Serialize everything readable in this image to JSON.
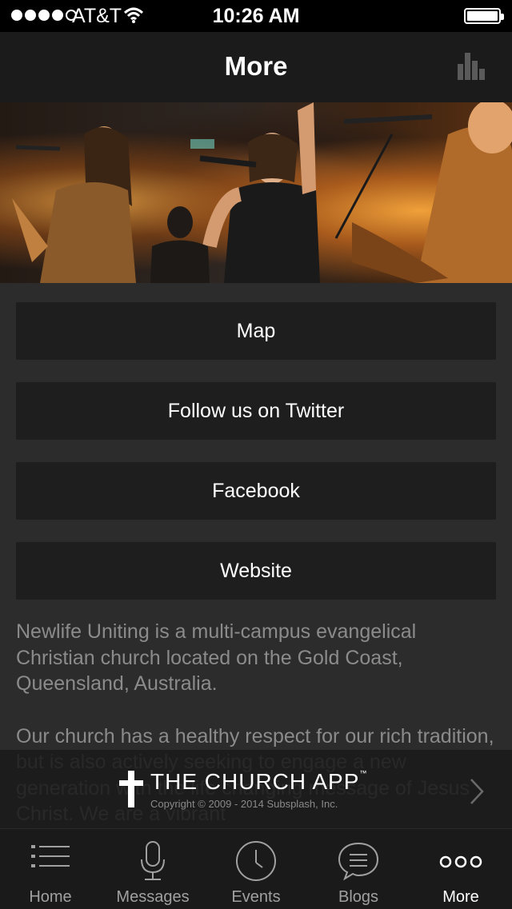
{
  "status_bar": {
    "carrier": "AT&T",
    "time": "10:26 AM"
  },
  "nav": {
    "title": "More",
    "right_icon": "chart-bars-icon"
  },
  "hero": {
    "alt": "worship-band-photo"
  },
  "buttons": [
    {
      "label": "Map"
    },
    {
      "label": "Follow us on Twitter"
    },
    {
      "label": "Facebook"
    },
    {
      "label": "Website"
    }
  ],
  "description": {
    "p1": "Newlife Uniting is a multi-campus evangelical Christian church located on the Gold Coast, Queensland, Australia.",
    "p2": "Our church has a healthy respect for our rich tradition, but is also actively seeking to engage a new generation with the life changing message of Jesus Christ. We are a vibrant"
  },
  "banner": {
    "brand": "THE CHURCH APP",
    "trademark": "™",
    "copyright": "Copyright © 2009 - 2014 Subsplash, Inc."
  },
  "tabs": [
    {
      "label": "Home",
      "icon": "list-icon"
    },
    {
      "label": "Messages",
      "icon": "microphone-icon"
    },
    {
      "label": "Events",
      "icon": "clock-icon"
    },
    {
      "label": "Blogs",
      "icon": "chat-bubble-icon"
    },
    {
      "label": "More",
      "icon": "more-dots-icon",
      "active": true
    }
  ]
}
